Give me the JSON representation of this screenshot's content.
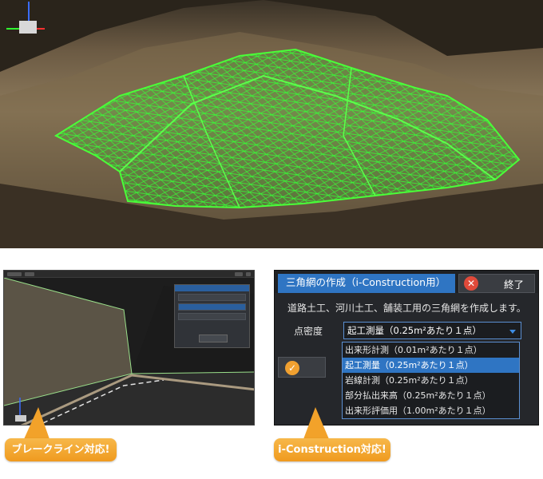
{
  "dialog": {
    "title": "三角網の作成（i-Construction用）",
    "close_label": "終了",
    "description": "道路土工、河川土工、舗装工用の三角網を作成します。",
    "density_label": "点密度",
    "selected_value": "起工測量（0.25m²あたり１点）",
    "options": [
      "出来形計測（0.01m²あたり１点）",
      "起工測量（0.25m²あたり１点）",
      "岩線計測（0.25m²あたり１点）",
      "部分払出来高（0.25m²あたり１点）",
      "出来形評価用（1.00m²あたり１点）"
    ],
    "selected_index": 1
  },
  "callouts": {
    "left": "ブレークライン対応!",
    "right": "i-Construction対応!"
  },
  "colors": {
    "mesh": "#2bff2b",
    "accent_blue": "#2f75c3",
    "callout_orange": "#f2a22a"
  }
}
